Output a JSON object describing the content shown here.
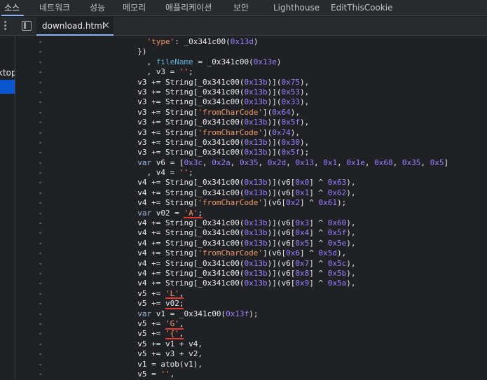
{
  "top_tabs": [
    {
      "label": "소스",
      "active": true
    },
    {
      "label": "네트워크"
    },
    {
      "label": "성능"
    },
    {
      "label": "메모리"
    },
    {
      "label": "애플리케이션"
    },
    {
      "label": "보안"
    },
    {
      "label": "Lighthouse"
    },
    {
      "label": "EditThisCookie"
    }
  ],
  "file_tab": {
    "label": "download.html",
    "close": "×"
  },
  "sidebar": {
    "label": "ktop"
  },
  "gutter_marker": "-",
  "code_lines": [
    [
      [
        "",
        "            "
      ],
      [
        "str",
        "'type'"
      ],
      [
        "",
        ": _0x341c00("
      ],
      [
        "num",
        "0x13d"
      ],
      [
        "",
        ")"
      ]
    ],
    [
      [
        "",
        "          })"
      ]
    ],
    [
      [
        "",
        "            , "
      ],
      [
        "prop",
        "fileName"
      ],
      [
        "",
        " = _0x341c00("
      ],
      [
        "num",
        "0x13e"
      ],
      [
        "",
        ")"
      ]
    ],
    [
      [
        "",
        "            , v3 = "
      ],
      [
        "str",
        "''"
      ],
      [
        "",
        ";"
      ]
    ],
    [
      [
        "",
        "          v3 += String[_0x341c00("
      ],
      [
        "num",
        "0x13b"
      ],
      [
        "",
        ")]("
      ],
      [
        "num",
        "0x75"
      ],
      [
        "",
        "),"
      ]
    ],
    [
      [
        "",
        "          v3 += String[_0x341c00("
      ],
      [
        "num",
        "0x13b"
      ],
      [
        "",
        ")]("
      ],
      [
        "num",
        "0x53"
      ],
      [
        "",
        "),"
      ]
    ],
    [
      [
        "",
        "          v3 += String[_0x341c00("
      ],
      [
        "num",
        "0x13b"
      ],
      [
        "",
        ")]("
      ],
      [
        "num",
        "0x33"
      ],
      [
        "",
        "),"
      ]
    ],
    [
      [
        "",
        "          v3 += String["
      ],
      [
        "str",
        "'fromCharCode'"
      ],
      [
        "",
        "]("
      ],
      [
        "num",
        "0x64"
      ],
      [
        "",
        "),"
      ]
    ],
    [
      [
        "",
        "          v3 += String[_0x341c00("
      ],
      [
        "num",
        "0x13b"
      ],
      [
        "",
        ")]("
      ],
      [
        "num",
        "0x5f"
      ],
      [
        "",
        "),"
      ]
    ],
    [
      [
        "",
        "          v3 += String["
      ],
      [
        "str",
        "'fromCharCode'"
      ],
      [
        "",
        "]("
      ],
      [
        "num",
        "0x74"
      ],
      [
        "",
        "),"
      ]
    ],
    [
      [
        "",
        "          v3 += String[_0x341c00("
      ],
      [
        "num",
        "0x13b"
      ],
      [
        "",
        ")]("
      ],
      [
        "num",
        "0x30"
      ],
      [
        "",
        "),"
      ]
    ],
    [
      [
        "",
        "          v3 += String[_0x341c00("
      ],
      [
        "num",
        "0x13b"
      ],
      [
        "",
        ")]("
      ],
      [
        "num",
        "0x5f"
      ],
      [
        "",
        ");"
      ]
    ],
    [
      [
        "",
        "          "
      ],
      [
        "kw",
        "var"
      ],
      [
        "",
        " v6 = ["
      ],
      [
        "num",
        "0x3c"
      ],
      [
        "",
        ", "
      ],
      [
        "num",
        "0x2a"
      ],
      [
        "",
        ", "
      ],
      [
        "num",
        "0x35"
      ],
      [
        "",
        ", "
      ],
      [
        "num",
        "0x2d"
      ],
      [
        "",
        ", "
      ],
      [
        "num",
        "0x13"
      ],
      [
        "",
        ", "
      ],
      [
        "num",
        "0x1"
      ],
      [
        "",
        ", "
      ],
      [
        "num",
        "0x1e"
      ],
      [
        "",
        ", "
      ],
      [
        "num",
        "0x68"
      ],
      [
        "",
        ", "
      ],
      [
        "num",
        "0x35"
      ],
      [
        "",
        ", "
      ],
      [
        "num",
        "0x5"
      ],
      [
        "",
        "]"
      ]
    ],
    [
      [
        "",
        "            , v4 = "
      ],
      [
        "str",
        "''"
      ],
      [
        "",
        ";"
      ]
    ],
    [
      [
        "",
        "          v4 += String[_0x341c00("
      ],
      [
        "num",
        "0x13b"
      ],
      [
        "",
        ")](v6["
      ],
      [
        "num",
        "0x0"
      ],
      [
        "",
        "] ^ "
      ],
      [
        "num",
        "0x63"
      ],
      [
        "",
        "),"
      ]
    ],
    [
      [
        "",
        "          v4 += String[_0x341c00("
      ],
      [
        "num",
        "0x13b"
      ],
      [
        "",
        ")](v6["
      ],
      [
        "num",
        "0x1"
      ],
      [
        "",
        "] ^ "
      ],
      [
        "num",
        "0x62"
      ],
      [
        "",
        "),"
      ]
    ],
    [
      [
        "",
        "          v4 += String["
      ],
      [
        "str",
        "'fromCharCode'"
      ],
      [
        "",
        "](v6["
      ],
      [
        "num",
        "0x2"
      ],
      [
        "",
        "] ^ "
      ],
      [
        "num",
        "0x61"
      ],
      [
        "",
        ");"
      ]
    ],
    [
      [
        "",
        "          "
      ],
      [
        "kw",
        "var"
      ],
      [
        "",
        " v02 = "
      ],
      [
        "str",
        "'A'"
      ],
      [
        "",
        ";"
      ]
    ],
    [
      [
        "",
        "          v4 += String[_0x341c00("
      ],
      [
        "num",
        "0x13b"
      ],
      [
        "",
        ")](v6["
      ],
      [
        "num",
        "0x3"
      ],
      [
        "",
        "] ^ "
      ],
      [
        "num",
        "0x60"
      ],
      [
        "",
        "),"
      ]
    ],
    [
      [
        "",
        "          v4 += String[_0x341c00("
      ],
      [
        "num",
        "0x13b"
      ],
      [
        "",
        ")](v6["
      ],
      [
        "num",
        "0x4"
      ],
      [
        "",
        "] ^ "
      ],
      [
        "num",
        "0x5f"
      ],
      [
        "",
        "),"
      ]
    ],
    [
      [
        "",
        "          v4 += String[_0x341c00("
      ],
      [
        "num",
        "0x13b"
      ],
      [
        "",
        ")](v6["
      ],
      [
        "num",
        "0x5"
      ],
      [
        "",
        "] ^ "
      ],
      [
        "num",
        "0x5e"
      ],
      [
        "",
        "),"
      ]
    ],
    [
      [
        "",
        "          v4 += String["
      ],
      [
        "str",
        "'fromCharCode'"
      ],
      [
        "",
        "](v6["
      ],
      [
        "num",
        "0x6"
      ],
      [
        "",
        "] ^ "
      ],
      [
        "num",
        "0x5d"
      ],
      [
        "",
        "),"
      ]
    ],
    [
      [
        "",
        "          v4 += String[_0x341c00("
      ],
      [
        "num",
        "0x13b"
      ],
      [
        "",
        ")](v6["
      ],
      [
        "num",
        "0x7"
      ],
      [
        "",
        "] ^ "
      ],
      [
        "num",
        "0x5c"
      ],
      [
        "",
        "),"
      ]
    ],
    [
      [
        "",
        "          v4 += String[_0x341c00("
      ],
      [
        "num",
        "0x13b"
      ],
      [
        "",
        ")](v6["
      ],
      [
        "num",
        "0x8"
      ],
      [
        "",
        "] ^ "
      ],
      [
        "num",
        "0x5b"
      ],
      [
        "",
        "),"
      ]
    ],
    [
      [
        "",
        "          v4 += String[_0x341c00("
      ],
      [
        "num",
        "0x13b"
      ],
      [
        "",
        ")](v6["
      ],
      [
        "num",
        "0x9"
      ],
      [
        "",
        "] ^ "
      ],
      [
        "num",
        "0x5a"
      ],
      [
        "",
        "),"
      ]
    ],
    [
      [
        "",
        "          v5 += "
      ],
      [
        "str",
        "'L'"
      ],
      [
        "",
        ","
      ]
    ],
    [
      [
        "",
        "          v5 += v02;"
      ]
    ],
    [
      [
        "",
        "          "
      ],
      [
        "kw",
        "var"
      ],
      [
        "",
        " v1 = _0x341c00("
      ],
      [
        "num",
        "0x13f"
      ],
      [
        "",
        ");"
      ]
    ],
    [
      [
        "",
        "          v5 += "
      ],
      [
        "str",
        "'G'"
      ],
      [
        "",
        ","
      ]
    ],
    [
      [
        "",
        "          v5 += "
      ],
      [
        "str",
        "'{'"
      ],
      [
        "",
        ","
      ]
    ],
    [
      [
        "",
        "          v5 += v1 + v4,"
      ]
    ],
    [
      [
        "",
        "          v5 += v3 + v2,"
      ]
    ],
    [
      [
        "",
        "          v1 = atob(v1),"
      ]
    ],
    [
      [
        "",
        "          v5 = "
      ],
      [
        "str",
        "''"
      ],
      [
        "",
        ","
      ]
    ]
  ],
  "annotations": [
    {
      "name": "underline-a",
      "line": 17,
      "from": 20,
      "to": 24
    },
    {
      "name": "underline-l",
      "line": 25,
      "from": 16,
      "to": 20
    },
    {
      "name": "underline-v02",
      "line": 26,
      "from": 16,
      "to": 20
    },
    {
      "name": "underline-g",
      "line": 28,
      "from": 16,
      "to": 20
    },
    {
      "name": "underline-brace",
      "line": 29,
      "from": 16,
      "to": 20
    }
  ],
  "colors": {
    "accent": "#8ab4f8",
    "annotation": "#e53935",
    "string": "#f29766",
    "number": "#9980ff",
    "keyword": "#9bbbdc"
  }
}
